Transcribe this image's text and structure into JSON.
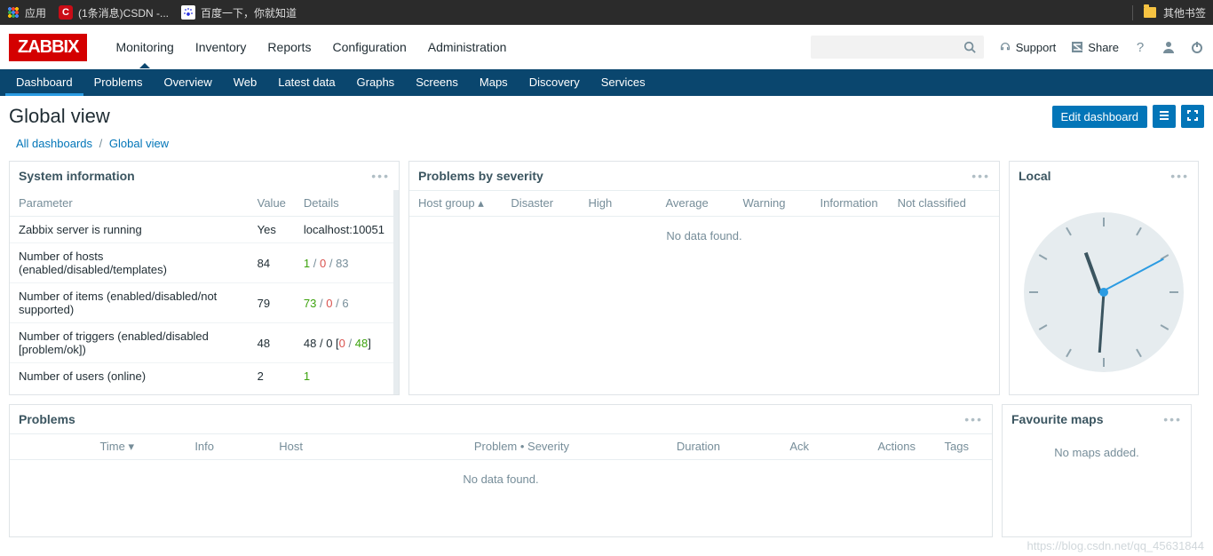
{
  "browser": {
    "apps": "应用",
    "csdn": "(1条消息)CSDN -...",
    "baidu": "百度一下，你就知道",
    "other": "其他书签"
  },
  "logo": "ZABBIX",
  "topnav": [
    "Monitoring",
    "Inventory",
    "Reports",
    "Configuration",
    "Administration"
  ],
  "header": {
    "support": "Support",
    "share": "Share",
    "help": "?"
  },
  "subnav": [
    "Dashboard",
    "Problems",
    "Overview",
    "Web",
    "Latest data",
    "Graphs",
    "Screens",
    "Maps",
    "Discovery",
    "Services"
  ],
  "page_title": "Global view",
  "edit_dashboard": "Edit dashboard",
  "breadcrumb": {
    "all": "All dashboards",
    "current": "Global view",
    "sep": "/"
  },
  "sysinfo": {
    "title": "System information",
    "cols": [
      "Parameter",
      "Value",
      "Details"
    ],
    "rows": [
      {
        "p": "Zabbix server is running",
        "v": "Yes",
        "vcls": "green",
        "d0": "localhost:10051"
      },
      {
        "p": "Number of hosts (enabled/disabled/templates)",
        "v": "84",
        "d_a": "1",
        "d_b": " / ",
        "d_c": "0",
        "d_d": " / ",
        "d_e": "83"
      },
      {
        "p": "Number of items (enabled/disabled/not supported)",
        "v": "79",
        "d_a": "73",
        "d_b": " / ",
        "d_c": "0",
        "d_d": " / ",
        "d_e": "6"
      },
      {
        "p": "Number of triggers (enabled/disabled [problem/ok])",
        "v": "48",
        "d_raw1": "48 / 0 [",
        "d_c": "0",
        "d_d": " / ",
        "d_e": "48",
        "d_raw2": "]"
      },
      {
        "p": "Number of users (online)",
        "v": "2",
        "d_a": "1"
      }
    ]
  },
  "severity": {
    "title": "Problems by severity",
    "cols": [
      "Host group ▴",
      "Disaster",
      "High",
      "Average",
      "Warning",
      "Information",
      "Not classified"
    ],
    "empty": "No data found."
  },
  "local": {
    "title": "Local"
  },
  "problems": {
    "title": "Problems",
    "cols": [
      "Time ▾",
      "Info",
      "Host",
      "Problem • Severity",
      "Duration",
      "Ack",
      "Actions",
      "Tags"
    ],
    "empty": "No data found."
  },
  "favmaps": {
    "title": "Favourite maps",
    "empty": "No maps added."
  },
  "watermark": "https://blog.csdn.net/qq_45631844"
}
